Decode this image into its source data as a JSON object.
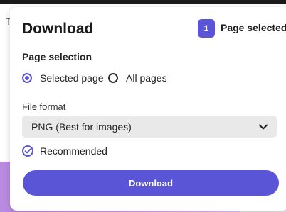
{
  "background": {
    "partial_text": "T"
  },
  "dialog": {
    "title": "Download",
    "selection_count": "1",
    "selection_label": "Page selected",
    "page_selection": {
      "label": "Page selection",
      "options": [
        {
          "label": "Selected page",
          "checked": true
        },
        {
          "label": "All pages",
          "checked": false
        }
      ]
    },
    "file_format": {
      "label": "File format",
      "value": "PNG (Best for images)",
      "icon": "chevron-down-icon"
    },
    "recommended": {
      "label": "Recommended",
      "icon": "check-circle-icon"
    },
    "download_button": "Download"
  },
  "colors": {
    "accent": "#5a55d6",
    "select_bg": "#e9e9e9",
    "topbar": "#1b1b1b"
  }
}
